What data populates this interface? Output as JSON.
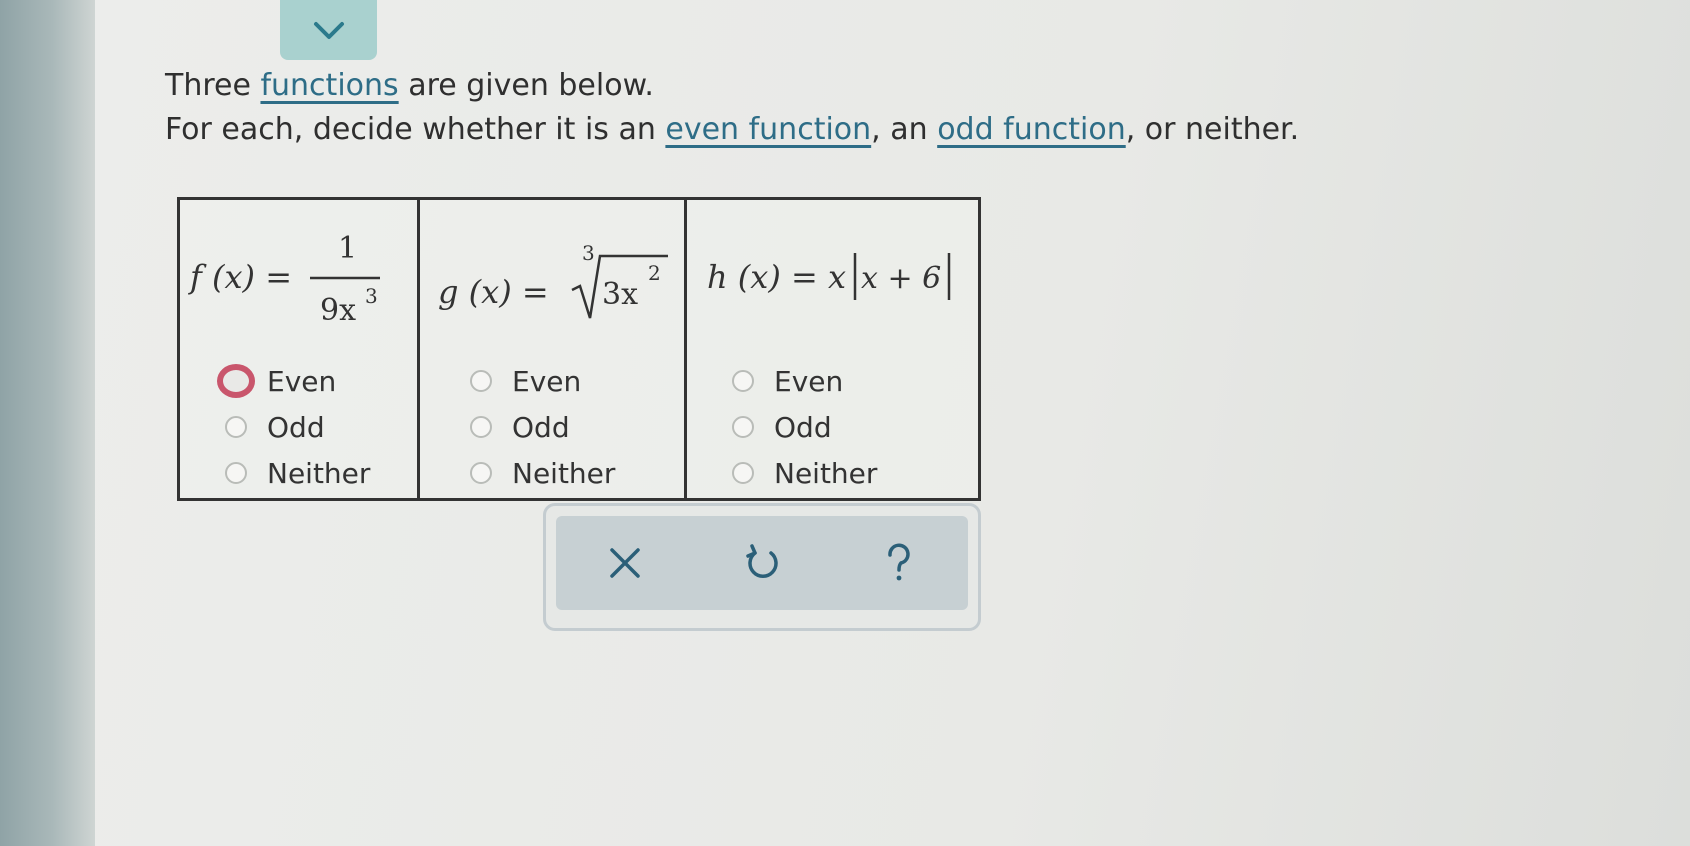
{
  "question": {
    "line1_prefix": "Three ",
    "line1_link": "functions",
    "line1_suffix": " are given below.",
    "line2_prefix": "For each, decide whether it is an ",
    "line2_link1": "even function",
    "line2_mid": ", an ",
    "line2_link2": "odd function",
    "line2_suffix": ", or neither."
  },
  "functions": [
    {
      "name": "f",
      "lhs": "f (x) =",
      "numerator": "1",
      "denominator": "9x",
      "denominator_exp": "3"
    },
    {
      "name": "g",
      "lhs": "g (x) =",
      "root_index": "3",
      "radicand": "3x",
      "radicand_exp": "2"
    },
    {
      "name": "h",
      "lhs": "h (x) = x",
      "abs_body": "x + 6"
    }
  ],
  "options": [
    "Even",
    "Odd",
    "Neither"
  ],
  "selected": {
    "f": "Even",
    "g": null,
    "h": null
  },
  "toolbar": {
    "clear_icon": "x-icon",
    "undo_icon": "undo-icon",
    "help_icon": "help-icon"
  },
  "colors": {
    "selected_radio": "#c9566c",
    "link": "#2e6d87",
    "toolbar": "#c7d0d3",
    "tab": "#a9d1cf"
  }
}
